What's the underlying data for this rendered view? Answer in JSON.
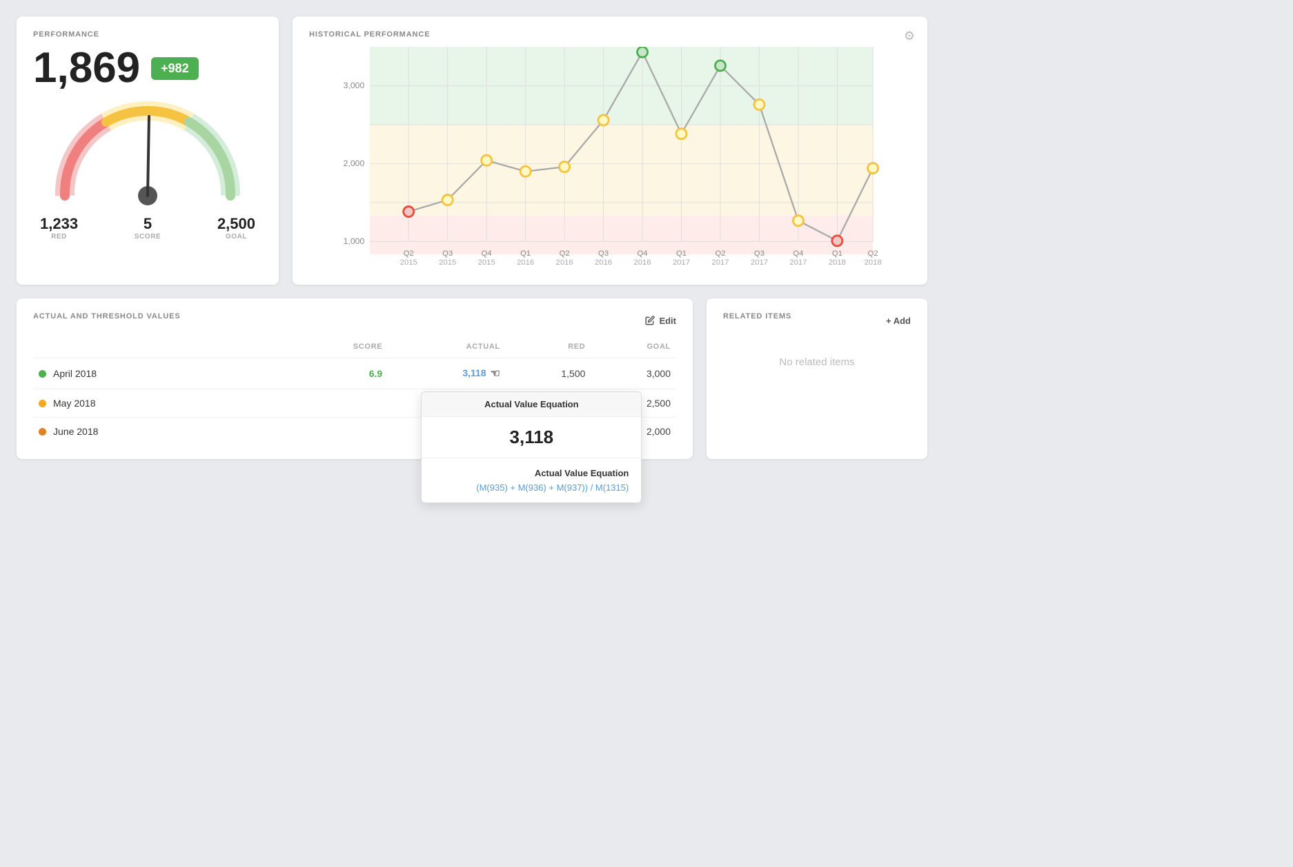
{
  "performance": {
    "title": "PERFORMANCE",
    "score": "1,869",
    "badge": "+982",
    "red_val": "1,233",
    "red_lbl": "RED",
    "score_val": "5",
    "score_lbl": "SCORE",
    "goal_val": "2,500",
    "goal_lbl": "GOAL"
  },
  "historical": {
    "title": "HISTORICAL PERFORMANCE",
    "gear_label": "⚙"
  },
  "threshold": {
    "title": "ACTUAL AND THRESHOLD VALUES",
    "edit_label": "Edit",
    "columns": [
      "",
      "SCORE",
      "ACTUAL",
      "RED",
      "GOAL"
    ],
    "rows": [
      {
        "period": "April 2018",
        "dot": "green",
        "score": "6.9",
        "actual": "3,118",
        "red": "1,500",
        "goal": "3,000",
        "actual_is_link": true
      },
      {
        "period": "May 2018",
        "dot": "yellow",
        "score": "",
        "actual": "",
        "red": "",
        "goal": "2,500",
        "actual_is_link": false
      },
      {
        "period": "June 2018",
        "dot": "orange",
        "score": "",
        "actual": "",
        "red": "",
        "goal": "2,000",
        "actual_is_link": false
      }
    ]
  },
  "tooltip": {
    "header": "Actual Value Equation",
    "value": "3,118",
    "body_title": "Actual Value Equation",
    "expression": "(M(935) + M(936) + M(937)) / M(1315)"
  },
  "related": {
    "title": "RELATED ITEMS",
    "add_label": "+ Add",
    "empty": "No related items"
  },
  "chart": {
    "quarters": [
      "Q2 2015",
      "Q3 2015",
      "Q4 2015",
      "Q1 2016",
      "Q2 2016",
      "Q3 2016",
      "Q4 2016",
      "Q1 2017",
      "Q2 2017",
      "Q3 2017",
      "Q4 2017",
      "Q1 2018",
      "Q2 2018"
    ],
    "values": [
      1380,
      1530,
      2040,
      1900,
      1960,
      2560,
      3430,
      2380,
      3260,
      2760,
      1270,
      1010,
      1940
    ],
    "colors": [
      "red",
      "yellow",
      "yellow",
      "yellow",
      "yellow",
      "yellow",
      "green",
      "yellow",
      "green",
      "yellow",
      "yellow",
      "red",
      "yellow"
    ]
  }
}
